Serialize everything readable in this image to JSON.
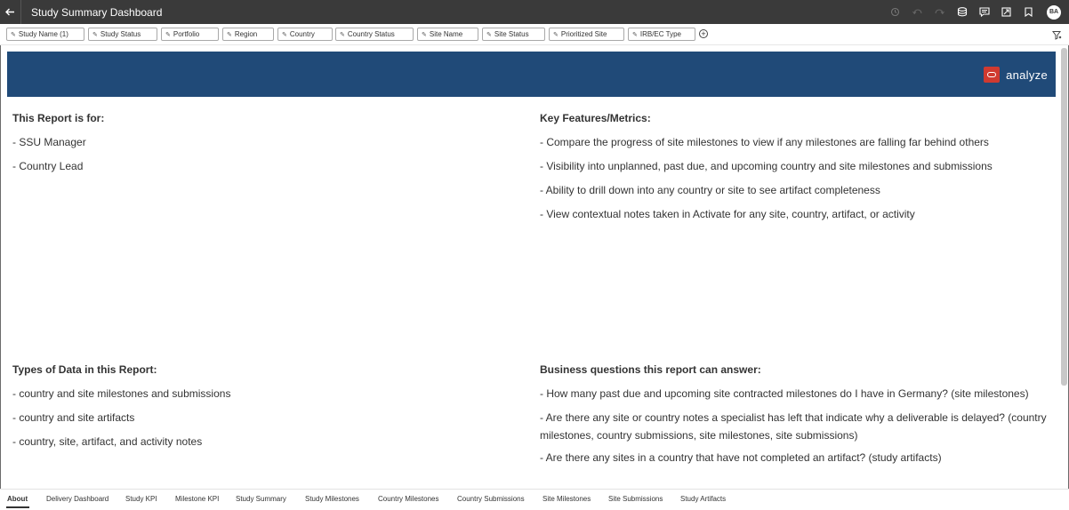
{
  "header": {
    "title": "Study Summary Dashboard",
    "avatar_initials": "BA",
    "icons": [
      "back-arrow-icon",
      "refresh-icon",
      "undo-icon",
      "redo-icon",
      "data-icon",
      "comment-icon",
      "present-icon",
      "bookmark-icon"
    ]
  },
  "filters": [
    {
      "label": "Study Name (1)"
    },
    {
      "label": "Study Status"
    },
    {
      "label": "Portfolio"
    },
    {
      "label": "Region"
    },
    {
      "label": "Country"
    },
    {
      "label": "Country Status"
    },
    {
      "label": "Site Name"
    },
    {
      "label": "Site Status"
    },
    {
      "label": "Prioritized Site"
    },
    {
      "label": "IRB/EC Type"
    }
  ],
  "filter_bar": {
    "add_symbol": "+"
  },
  "banner": {
    "brand_text": "analyze",
    "color": "#204a78",
    "logo_color": "#d03a30"
  },
  "content": {
    "report_for": {
      "heading": "This Report is for:",
      "items": [
        "- SSU Manager",
        "- Country Lead"
      ]
    },
    "key_features": {
      "heading": "Key Features/Metrics:",
      "items": [
        "- Compare the progress of site milestones to view if any milestones are falling far behind others",
        "- Visibility into unplanned, past due, and upcoming country and site milestones and submissions",
        "- Ability to drill down into any country or site to see artifact completeness",
        "- View contextual notes taken in Activate for any site, country, artifact, or activity"
      ]
    },
    "data_types": {
      "heading": "Types of Data in this Report:",
      "items": [
        "- country and site milestones and submissions",
        "- country and site artifacts",
        "- country, site, artifact, and activity notes"
      ]
    },
    "business_questions": {
      "heading": "Business questions this report can answer:",
      "items": [
        "- How many past due and upcoming site contracted milestones do I have in Germany? (site milestones)",
        "- Are there any site or country notes a specialist has left that indicate why a deliverable is delayed? (country milestones, country submissions, site milestones, site submissions)",
        "- Are there any sites in a country that have not completed an artifact? (study artifacts)"
      ]
    }
  },
  "tabs": [
    {
      "label": "About",
      "active": true
    },
    {
      "label": "Delivery Dashboard"
    },
    {
      "label": "Study KPI"
    },
    {
      "label": "Milestone KPI"
    },
    {
      "label": "Study Summary"
    },
    {
      "label": "Study Milestones"
    },
    {
      "label": "Country Milestones"
    },
    {
      "label": "Country Submissions"
    },
    {
      "label": "Site Milestones"
    },
    {
      "label": "Site Submissions"
    },
    {
      "label": "Study Artifacts"
    }
  ]
}
